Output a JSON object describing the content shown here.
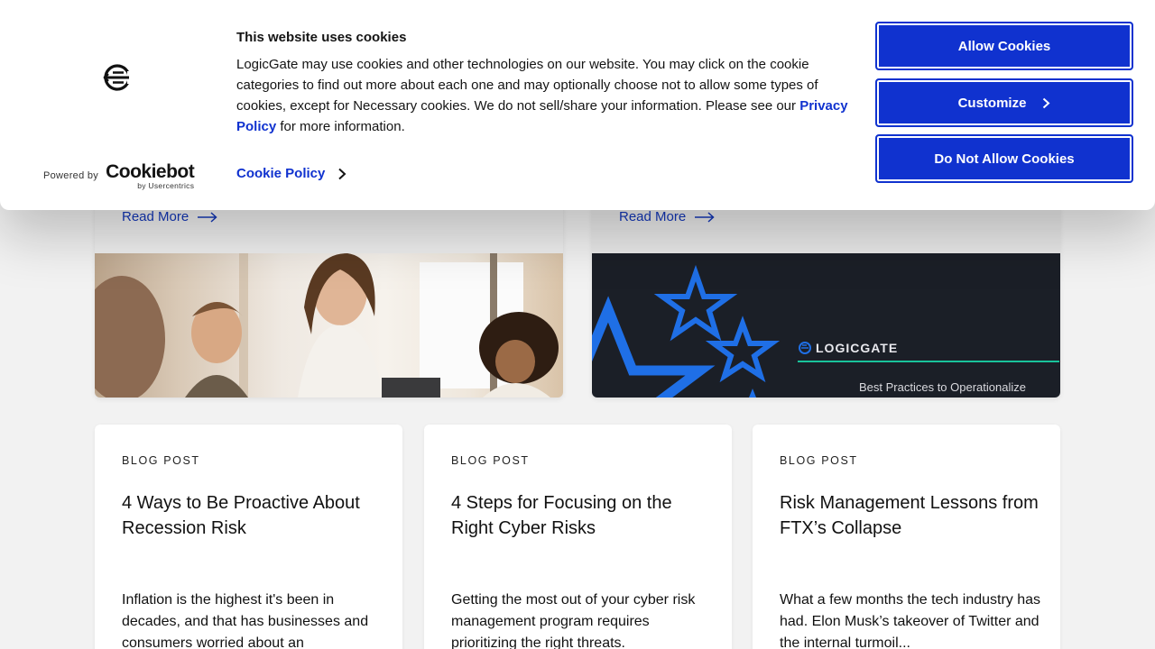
{
  "cookie_banner": {
    "heading": "This website uses cookies",
    "body_before_link": "LogicGate may use cookies and other technologies on our website. You may click on the cookie categories to find out more about each one and may optionally choose not to allow some types of cookies, except for Necessary cookies.  We do not sell/share your information. Please see our ",
    "privacy_link": "Privacy Policy",
    "body_after_link": " for more information.",
    "cookie_policy_link": "Cookie Policy",
    "powered_by": "Powered by",
    "cookiebot_name": "Cookiebot",
    "cookiebot_sub": "by Usercentrics",
    "buttons": {
      "allow": "Allow Cookies",
      "customize": "Customize",
      "deny": "Do Not Allow Cookies"
    },
    "accent_color": "#1032cf"
  },
  "featured": [
    {
      "read_more": "Read More"
    },
    {
      "read_more": "Read More",
      "image_brand": "LOGICGATE",
      "image_caption": "Best Practices to Operationalize"
    }
  ],
  "blog_cards": [
    {
      "kind": "BLOG POST",
      "title": "4 Ways to Be Proactive About Recession Risk",
      "excerpt": "Inflation is the highest it's been in decades, and that has businesses and consumers worried about an"
    },
    {
      "kind": "BLOG POST",
      "title": "4 Steps for Focusing on the Right Cyber Risks",
      "excerpt": "Getting the most out of your cyber risk management program requires prioritizing the right threats."
    },
    {
      "kind": "BLOG POST",
      "title": "Risk Management Lessons from FTX’s Collapse",
      "excerpt": "What a few months the tech industry has had.  Elon Musk’s takeover of Twitter and the internal turmoil..."
    }
  ]
}
